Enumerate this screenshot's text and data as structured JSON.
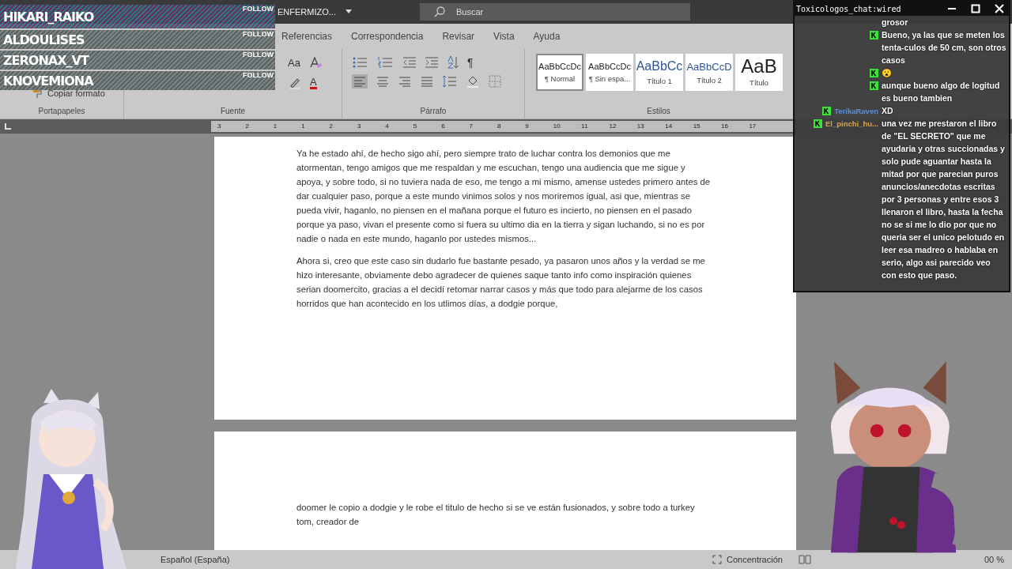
{
  "follow_overlay": {
    "items": [
      {
        "name": "HIKARI_RAIKO",
        "action": "FOLLOW"
      },
      {
        "name": "ALDOULISES",
        "action": "FOLLOW"
      },
      {
        "name": "ZERONAX_VT",
        "action": "FOLLOW"
      },
      {
        "name": "KNOVEMIONA",
        "action": "FOLLOW"
      }
    ]
  },
  "titlebar": {
    "document": "ENFERMIZO...",
    "search": {
      "placeholder": "Buscar"
    }
  },
  "tabs": [
    {
      "label": "Referencias",
      "selected": false
    },
    {
      "label": "Correspondencia",
      "selected": false
    },
    {
      "label": "Revisar",
      "selected": false
    },
    {
      "label": "Vista",
      "selected": false
    },
    {
      "label": "Ayuda",
      "selected": false
    }
  ],
  "ribbon": {
    "groups": [
      "Portapapeles",
      "Fuente",
      "Párrafo",
      "Estilos"
    ],
    "format_painter": "Copiar formato",
    "change_case": "Aa",
    "font_color": "A",
    "pilcrow": "¶",
    "styles": [
      {
        "preview": "AaBbCcDc",
        "name": "¶ Normal",
        "kind": "body",
        "selected": true
      },
      {
        "preview": "AaBbCcDc",
        "name": "¶ Sin espa...",
        "kind": "body",
        "selected": false
      },
      {
        "preview": "AaBbCc",
        "name": "Título 1",
        "kind": "heading1",
        "selected": false
      },
      {
        "preview": "AaBbCcD",
        "name": "Título 2",
        "kind": "heading2",
        "selected": false
      },
      {
        "preview": "AaB",
        "name": "Título",
        "kind": "title",
        "selected": false
      }
    ]
  },
  "ruler": [
    "3",
    "2",
    "1",
    "1",
    "2",
    "3",
    "4",
    "5",
    "6",
    "7",
    "8",
    "9",
    "10",
    "11",
    "12",
    "13",
    "14",
    "15",
    "16",
    "17"
  ],
  "document": {
    "pages": [
      {
        "paragraphs": [
          "Ya he estado ahí, de hecho sigo ahí, pero siempre trato de luchar contra los demonios que me atormentan, tengo amigos que me respaldan y me escuchan, tengo una audiencia que me sigue y apoya, y sobre todo, si no tuviera nada de eso, me tengo a mi mismo, amense ustedes primero antes de dar cualquier paso, porque a este mundo vinimos solos y nos moriremos igual, asi que, mientras se pueda vivir, haganlo, no piensen en el mañana porque el futuro es incierto, no piensen en el pasado porque ya paso, vivan el presente como si fuera su ultimo dia en la tierra y sigan luchando, si no es por nadie o nada en este mundo, haganlo por ustedes mismos...",
          "Ahora si, creo que este caso sin dudarlo fue bastante pesado, ya pasaron unos años y la verdad se me hizo interesante, obviamente debo agradecer de quienes saque tanto info como inspiración quienes serian doomercito, gracias a el decidí retomar narrar casos y más que todo para alejarme de los casos horridos que han acontecido en los utlimos días, a dodgie porque,"
        ]
      },
      {
        "paragraphs": [
          "doomer le copio a dodgie y le robe el titulo de hecho si se ve están fusionados, y sobre todo a turkey tom, creador de"
        ]
      }
    ]
  },
  "status_bar": {
    "language": "Español (España)",
    "focus": "Concentración",
    "zoom": "00 %"
  },
  "chat": {
    "title": "Toxicologos_chat:wired",
    "messages": [
      {
        "badge": false,
        "text": "grosor"
      },
      {
        "badge": true,
        "text": "Bueno, ya las que se meten los tenta-culos de 50 cm, son otros casos"
      },
      {
        "badge": true,
        "text": "😮"
      },
      {
        "badge": true,
        "text": "aunque bueno algo de logitud es bueno tambien"
      },
      {
        "badge": true,
        "user": "TerikaRaven",
        "color": "#5b8fd6",
        "text": "XD"
      },
      {
        "badge": true,
        "user": "El_pinchi_hu...",
        "color": "#d9a54a",
        "text": "una vez me prestaron el libro de \"EL SECRETO\" que me ayudaria y otras succionadas y solo pude aguantar hasta la mitad por que parecian puros anuncios/anecdotas escritas por 3 personas y entre esos 3 llenaron el libro, hasta la fecha no se si me lo dio por que no queria ser el unico pelotudo en leer esa madreo o hablaba en serio, algo asi parecido veo con esto que paso."
      }
    ]
  }
}
